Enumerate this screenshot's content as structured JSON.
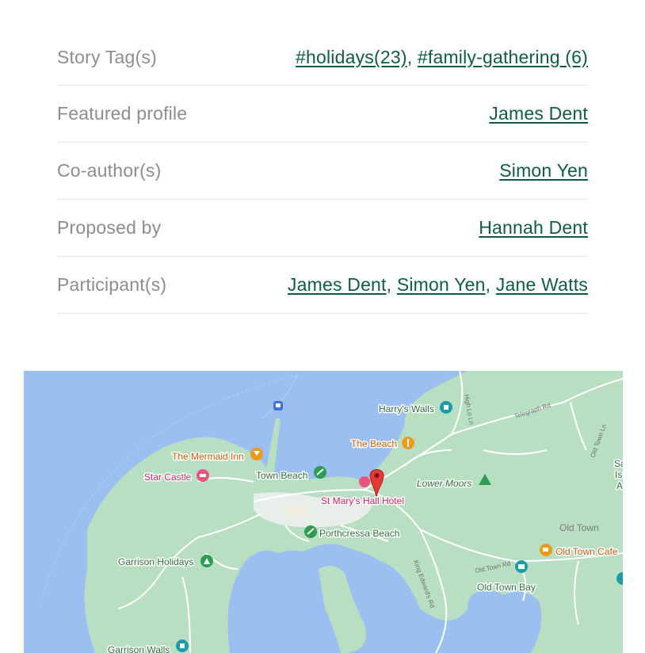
{
  "details": [
    {
      "label": "Story Tag(s)",
      "links": [
        "#holidays(23)",
        "#family-gathering (6)"
      ]
    },
    {
      "label": "Featured profile",
      "links": [
        "James Dent"
      ]
    },
    {
      "label": "Co-author(s)",
      "links": [
        "Simon Yen"
      ]
    },
    {
      "label": "Proposed by",
      "links": [
        "Hannah Dent"
      ]
    },
    {
      "label": "Participant(s)",
      "links": [
        "James Dent",
        "Simon Yen",
        "Jane Watts"
      ]
    }
  ],
  "map": {
    "places": {
      "harrys_walls": "Harry's Walls",
      "the_beach": "The Beach",
      "mermaid_inn": "The Mermaid Inn",
      "star_castle": "Star Castle",
      "town_beach": "Town Beach",
      "lower_moors": "Lower Moors",
      "st_marys_hall": "St Mary's Hall Hotel",
      "old_town": "Old Town",
      "old_town_cafe": "Old Town Cafe",
      "porthcressa": "Porthcressa Beach",
      "garrison_holidays": "Garrison Holidays",
      "old_town_bay": "Old Town Bay",
      "garrison_walls": "Garrison Walls",
      "edge_sa": "Sa",
      "edge_is": "Is",
      "edge_a": "A"
    },
    "roads": {
      "telegraph": "Telegraph Rd",
      "old_town_ln": "Old Town Ln",
      "king_edwards": "King Edward's Rd",
      "old_town_rd": "Old Town Rd",
      "high_lo_ln": "High Lo Ln"
    }
  }
}
